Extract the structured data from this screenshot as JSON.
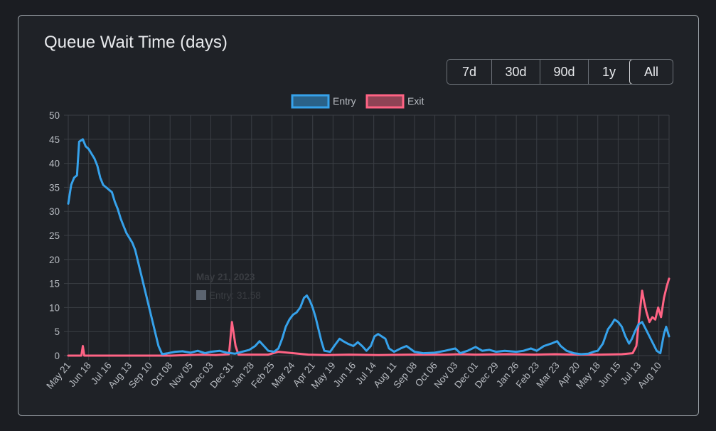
{
  "card": {
    "title": "Queue Wait Time (days)"
  },
  "range_buttons": [
    {
      "label": "7d",
      "active": false
    },
    {
      "label": "30d",
      "active": false
    },
    {
      "label": "90d",
      "active": false
    },
    {
      "label": "1y",
      "active": false
    },
    {
      "label": "All",
      "active": true
    }
  ],
  "tooltip": {
    "title": "May 21, 2023",
    "body": "Entry: 31.58",
    "swatch_color": "#5b6470"
  },
  "chart_data": {
    "type": "line",
    "title": "",
    "xlabel": "",
    "ylabel": "",
    "ylim": [
      0,
      50
    ],
    "yticks": [
      0,
      5,
      10,
      15,
      20,
      25,
      30,
      35,
      40,
      45,
      50
    ],
    "xlim": [
      "2023-05-21",
      "2025-08-24"
    ],
    "xticks": [
      "May 21",
      "Jun 18",
      "Jul 16",
      "Aug 13",
      "Sep 10",
      "Oct 08",
      "Nov 05",
      "Dec 03",
      "Dec 31",
      "Jan 28",
      "Feb 25",
      "Mar 24",
      "Apr 21",
      "May 19",
      "Jun 16",
      "Jul 14",
      "Aug 11",
      "Sep 08",
      "Oct 06",
      "Nov 03",
      "Dec 01",
      "Dec 29",
      "Jan 26",
      "Feb 23",
      "Mar 23",
      "Apr 20",
      "May 18",
      "Jun 15",
      "Jul 13",
      "Aug 10"
    ],
    "xtick_dates": [
      "2023-05-21",
      "2023-06-18",
      "2023-07-16",
      "2023-08-13",
      "2023-09-10",
      "2023-10-08",
      "2023-11-05",
      "2023-12-03",
      "2023-12-31",
      "2024-01-28",
      "2024-02-25",
      "2024-03-24",
      "2024-04-21",
      "2024-05-19",
      "2024-06-16",
      "2024-07-14",
      "2024-08-11",
      "2024-09-08",
      "2024-10-06",
      "2024-11-03",
      "2024-12-01",
      "2024-12-29",
      "2025-01-26",
      "2025-02-23",
      "2025-03-23",
      "2025-04-20",
      "2025-05-18",
      "2025-06-15",
      "2025-07-13",
      "2025-08-10"
    ],
    "grid": true,
    "legend_position": "top",
    "series": [
      {
        "name": "Entry",
        "color": "#36a2eb",
        "points": [
          [
            "2023-05-21",
            31.6
          ],
          [
            "2023-05-25",
            35.5
          ],
          [
            "2023-05-29",
            37.0
          ],
          [
            "2023-06-02",
            37.5
          ],
          [
            "2023-06-05",
            44.5
          ],
          [
            "2023-06-10",
            45.0
          ],
          [
            "2023-06-14",
            43.5
          ],
          [
            "2023-06-18",
            43.0
          ],
          [
            "2023-06-22",
            42.0
          ],
          [
            "2023-06-26",
            41.0
          ],
          [
            "2023-06-30",
            39.5
          ],
          [
            "2023-07-04",
            37.0
          ],
          [
            "2023-07-08",
            35.5
          ],
          [
            "2023-07-12",
            35.0
          ],
          [
            "2023-07-16",
            34.5
          ],
          [
            "2023-07-20",
            34.0
          ],
          [
            "2023-07-24",
            32.0
          ],
          [
            "2023-07-28",
            30.5
          ],
          [
            "2023-08-01",
            28.5
          ],
          [
            "2023-08-05",
            27.0
          ],
          [
            "2023-08-09",
            25.5
          ],
          [
            "2023-08-13",
            24.5
          ],
          [
            "2023-08-17",
            23.5
          ],
          [
            "2023-08-21",
            22.0
          ],
          [
            "2023-08-25",
            19.5
          ],
          [
            "2023-08-29",
            17.0
          ],
          [
            "2023-09-02",
            14.5
          ],
          [
            "2023-09-06",
            12.0
          ],
          [
            "2023-09-10",
            9.5
          ],
          [
            "2023-09-14",
            7.0
          ],
          [
            "2023-09-18",
            4.5
          ],
          [
            "2023-09-22",
            2.0
          ],
          [
            "2023-09-27",
            0.3
          ],
          [
            "2023-10-05",
            0.5
          ],
          [
            "2023-10-15",
            0.8
          ],
          [
            "2023-10-25",
            0.9
          ],
          [
            "2023-11-05",
            0.6
          ],
          [
            "2023-11-15",
            1.0
          ],
          [
            "2023-11-25",
            0.5
          ],
          [
            "2023-12-03",
            0.8
          ],
          [
            "2023-12-15",
            1.0
          ],
          [
            "2023-12-25",
            0.6
          ],
          [
            "2024-01-05",
            0.4
          ],
          [
            "2024-01-15",
            0.8
          ],
          [
            "2024-01-25",
            1.2
          ],
          [
            "2024-02-02",
            2.0
          ],
          [
            "2024-02-08",
            3.0
          ],
          [
            "2024-02-14",
            2.0
          ],
          [
            "2024-02-20",
            1.0
          ],
          [
            "2024-02-28",
            0.8
          ],
          [
            "2024-03-05",
            1.5
          ],
          [
            "2024-03-10",
            3.5
          ],
          [
            "2024-03-15",
            6.0
          ],
          [
            "2024-03-20",
            7.5
          ],
          [
            "2024-03-25",
            8.5
          ],
          [
            "2024-03-30",
            9.0
          ],
          [
            "2024-04-04",
            10.0
          ],
          [
            "2024-04-09",
            12.0
          ],
          [
            "2024-04-13",
            12.5
          ],
          [
            "2024-04-17",
            11.5
          ],
          [
            "2024-04-21",
            10.0
          ],
          [
            "2024-04-25",
            8.0
          ],
          [
            "2024-04-29",
            5.5
          ],
          [
            "2024-05-03",
            3.0
          ],
          [
            "2024-05-07",
            1.0
          ],
          [
            "2024-05-15",
            0.8
          ],
          [
            "2024-05-23",
            2.5
          ],
          [
            "2024-05-28",
            3.5
          ],
          [
            "2024-06-02",
            3.0
          ],
          [
            "2024-06-08",
            2.5
          ],
          [
            "2024-06-16",
            2.0
          ],
          [
            "2024-06-22",
            2.8
          ],
          [
            "2024-06-28",
            2.0
          ],
          [
            "2024-07-04",
            1.0
          ],
          [
            "2024-07-10",
            2.0
          ],
          [
            "2024-07-15",
            4.0
          ],
          [
            "2024-07-20",
            4.5
          ],
          [
            "2024-07-25",
            4.0
          ],
          [
            "2024-07-30",
            3.5
          ],
          [
            "2024-08-04",
            1.5
          ],
          [
            "2024-08-11",
            0.8
          ],
          [
            "2024-08-20",
            1.5
          ],
          [
            "2024-08-28",
            2.0
          ],
          [
            "2024-09-08",
            0.8
          ],
          [
            "2024-09-20",
            0.5
          ],
          [
            "2024-10-06",
            0.6
          ],
          [
            "2024-10-20",
            1.0
          ],
          [
            "2024-11-03",
            1.5
          ],
          [
            "2024-11-10",
            0.5
          ],
          [
            "2024-11-20",
            1.0
          ],
          [
            "2024-12-01",
            1.8
          ],
          [
            "2024-12-10",
            1.0
          ],
          [
            "2024-12-20",
            1.2
          ],
          [
            "2024-12-29",
            0.8
          ],
          [
            "2025-01-10",
            1.0
          ],
          [
            "2025-01-26",
            0.8
          ],
          [
            "2025-02-05",
            1.0
          ],
          [
            "2025-02-15",
            1.5
          ],
          [
            "2025-02-23",
            1.0
          ],
          [
            "2025-03-05",
            2.0
          ],
          [
            "2025-03-15",
            2.5
          ],
          [
            "2025-03-23",
            3.0
          ],
          [
            "2025-03-28",
            2.0
          ],
          [
            "2025-04-05",
            1.0
          ],
          [
            "2025-04-15",
            0.5
          ],
          [
            "2025-04-25",
            0.3
          ],
          [
            "2025-05-05",
            0.4
          ],
          [
            "2025-05-12",
            0.8
          ],
          [
            "2025-05-18",
            1.0
          ],
          [
            "2025-05-25",
            2.5
          ],
          [
            "2025-06-01",
            5.5
          ],
          [
            "2025-06-06",
            6.5
          ],
          [
            "2025-06-10",
            7.5
          ],
          [
            "2025-06-15",
            7.0
          ],
          [
            "2025-06-20",
            6.0
          ],
          [
            "2025-06-25",
            4.0
          ],
          [
            "2025-06-30",
            2.5
          ],
          [
            "2025-07-04",
            3.5
          ],
          [
            "2025-07-08",
            5.0
          ],
          [
            "2025-07-13",
            6.5
          ],
          [
            "2025-07-18",
            7.0
          ],
          [
            "2025-07-23",
            5.5
          ],
          [
            "2025-07-28",
            4.0
          ],
          [
            "2025-08-02",
            2.5
          ],
          [
            "2025-08-07",
            1.0
          ],
          [
            "2025-08-12",
            0.5
          ],
          [
            "2025-08-17",
            4.5
          ],
          [
            "2025-08-20",
            6.0
          ],
          [
            "2025-08-24",
            4.0
          ]
        ]
      },
      {
        "name": "Exit",
        "color": "#ff6384",
        "points": [
          [
            "2023-05-21",
            0.0
          ],
          [
            "2023-06-08",
            0.0
          ],
          [
            "2023-06-10",
            2.0
          ],
          [
            "2023-06-12",
            0.0
          ],
          [
            "2023-07-10",
            0.0
          ],
          [
            "2023-10-10",
            0.0
          ],
          [
            "2023-11-20",
            0.2
          ],
          [
            "2023-12-10",
            0.1
          ],
          [
            "2023-12-28",
            0.3
          ],
          [
            "2024-01-01",
            7.0
          ],
          [
            "2024-01-06",
            2.0
          ],
          [
            "2024-01-10",
            0.2
          ],
          [
            "2024-02-20",
            0.2
          ],
          [
            "2024-03-05",
            0.8
          ],
          [
            "2024-04-15",
            0.2
          ],
          [
            "2024-05-10",
            0.1
          ],
          [
            "2024-06-10",
            0.2
          ],
          [
            "2024-07-20",
            0.1
          ],
          [
            "2024-09-01",
            0.2
          ],
          [
            "2024-10-20",
            0.2
          ],
          [
            "2024-11-10",
            0.3
          ],
          [
            "2024-12-01",
            0.2
          ],
          [
            "2025-01-15",
            0.3
          ],
          [
            "2025-02-20",
            0.2
          ],
          [
            "2025-03-20",
            0.3
          ],
          [
            "2025-04-20",
            0.2
          ],
          [
            "2025-05-20",
            0.2
          ],
          [
            "2025-06-20",
            0.3
          ],
          [
            "2025-07-05",
            0.5
          ],
          [
            "2025-07-10",
            2.0
          ],
          [
            "2025-07-14",
            8.0
          ],
          [
            "2025-07-18",
            13.5
          ],
          [
            "2025-07-21",
            11.0
          ],
          [
            "2025-07-24",
            9.0
          ],
          [
            "2025-07-28",
            7.0
          ],
          [
            "2025-08-01",
            8.0
          ],
          [
            "2025-08-05",
            7.5
          ],
          [
            "2025-08-09",
            10.0
          ],
          [
            "2025-08-13",
            8.0
          ],
          [
            "2025-08-17",
            12.0
          ],
          [
            "2025-08-21",
            14.5
          ],
          [
            "2025-08-24",
            16.0
          ]
        ]
      }
    ]
  }
}
